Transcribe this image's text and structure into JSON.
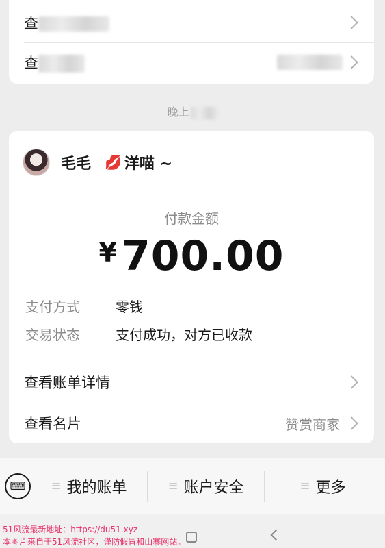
{
  "top_card": {
    "row1_label": "查看账单详情",
    "row2_label": "查看名片"
  },
  "time_label": "晚上",
  "payment": {
    "username": "毛毛",
    "nickname_emoji": "💋",
    "nickname": "洋喵 ~",
    "amount_label": "付款金额",
    "currency": "¥",
    "amount": "700.00",
    "method_key": "支付方式",
    "method_value": "零钱",
    "status_key": "交易状态",
    "status_value": "支付成功，对方已收款",
    "bill_detail_label": "查看账单详情",
    "card_label": "查看名片",
    "card_right": "赞赏商家"
  },
  "bottom_menu": {
    "keyboard_glyph": "⌨",
    "items": [
      {
        "label": "我的账单"
      },
      {
        "label": "账户安全"
      },
      {
        "label": "更多"
      }
    ]
  },
  "watermark": {
    "line1": "51风流最新地址：https://du51.xyz",
    "line2": "本图片来自于51风流社区，谨防假冒和山寨网站。"
  }
}
